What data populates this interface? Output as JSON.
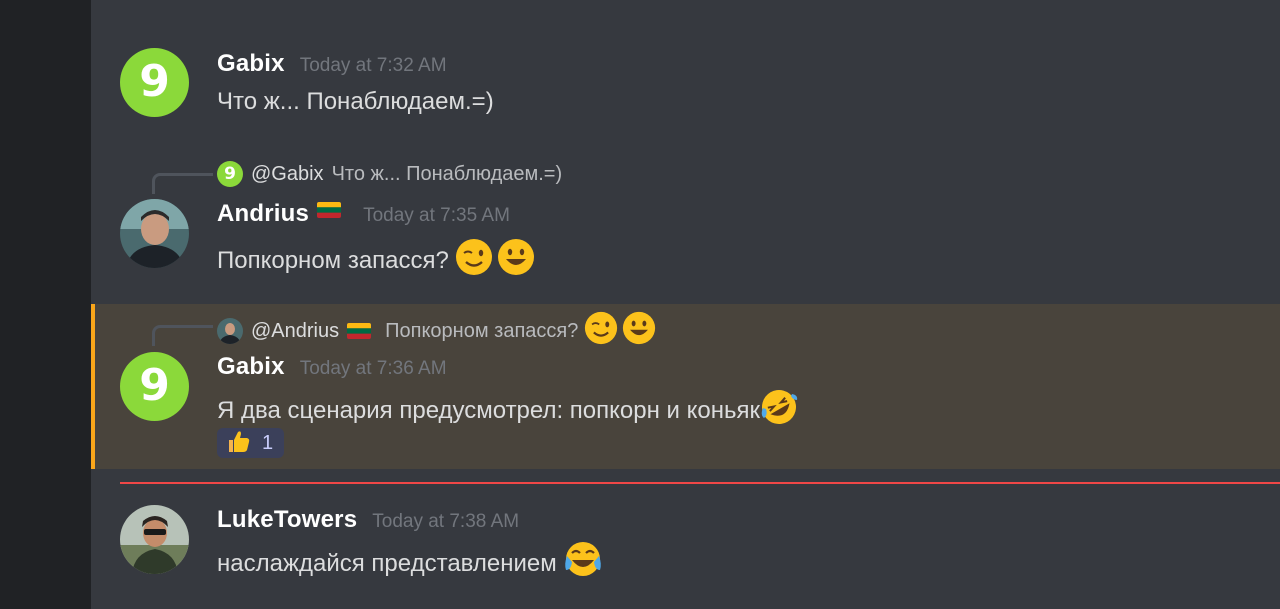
{
  "messages": [
    {
      "username": "Gabix",
      "timestamp": "Today at 7:32 AM",
      "text": "Что ж... Понаблюдаем.=)",
      "avatar_glyph": "9"
    },
    {
      "reply": {
        "user": "@Gabix",
        "text": "Что ж... Понаблюдаем.=)",
        "avatar_glyph": "9"
      },
      "username": "Andrius",
      "flag": "lithuania-flag",
      "timestamp": "Today at 7:35 AM",
      "text": "Попкорном запасся?",
      "emojis": [
        "winking-face-emoji",
        "grinning-face-emoji"
      ]
    },
    {
      "reply": {
        "user": "@Andrius",
        "flag": "lithuania-flag",
        "text": "Попкорном запасся?",
        "emojis": [
          "winking-face-emoji",
          "grinning-face-emoji"
        ]
      },
      "username": "Gabix",
      "timestamp": "Today at 7:36 AM",
      "text": "Я два сценария предусмотрел: попкорн и коньяк",
      "emojis": [
        "rolling-on-floor-laughing-emoji"
      ],
      "avatar_glyph": "9",
      "highlighted": true,
      "reaction": {
        "emoji": "thumbs-up-emoji",
        "count": "1"
      }
    },
    {
      "username": "LukeTowers",
      "timestamp": "Today at 7:38 AM",
      "text": "наслаждайся представлением",
      "emojis": [
        "face-with-tears-of-joy-emoji"
      ]
    }
  ],
  "colors": {
    "background": "#36393f",
    "left_rail": "#202225",
    "highlight_bg": "#49443c",
    "highlight_bar": "#faa61a",
    "new_messages_divider": "#f04747",
    "gabix_avatar": "#8bd93a"
  }
}
